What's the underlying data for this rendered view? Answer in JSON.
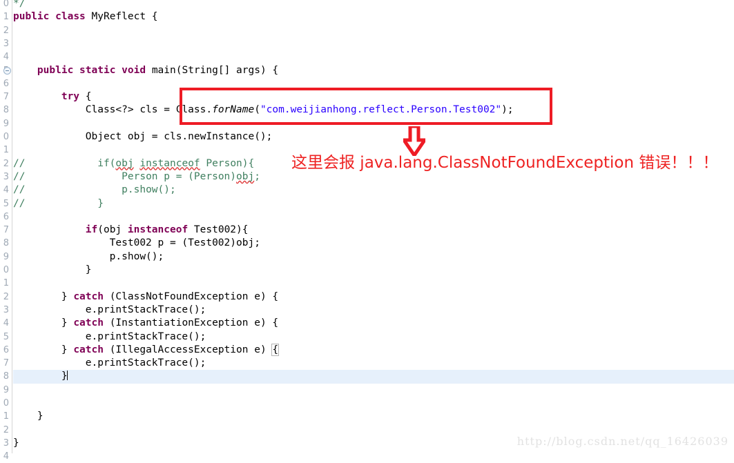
{
  "editor": {
    "font_size_px": 14.5,
    "line_height_px": 19.3,
    "gutter_color": "#9fa9b5",
    "current_line_bg": "#e6f0fb",
    "colors": {
      "keyword": "#7f0055",
      "string": "#2a00ff",
      "comment": "#3f7f5f",
      "plain": "#000000",
      "annotation_red": "#ee1c25",
      "watermark": "#e2e2e2"
    },
    "lines": [
      {
        "num": "0",
        "indent": 1,
        "fold": false,
        "current": false,
        "clipped_top": true,
        "segments": [
          {
            "t": "*/",
            "c": "cmt"
          }
        ]
      },
      {
        "num": "1",
        "indent": 0,
        "fold": false,
        "current": false,
        "segments": [
          {
            "t": "public",
            "c": "kw"
          },
          {
            "t": " ",
            "c": "plain"
          },
          {
            "t": "class",
            "c": "kw"
          },
          {
            "t": " MyReflect {",
            "c": "plain"
          }
        ]
      },
      {
        "num": "2",
        "indent": 0,
        "fold": false,
        "current": false,
        "segments": []
      },
      {
        "num": "3",
        "indent": 0,
        "fold": false,
        "current": false,
        "segments": []
      },
      {
        "num": "4",
        "indent": 0,
        "fold": false,
        "current": false,
        "segments": []
      },
      {
        "num": "5",
        "indent": 0,
        "fold": true,
        "current": false,
        "segments": [
          {
            "t": "    ",
            "c": "plain"
          },
          {
            "t": "public",
            "c": "kw"
          },
          {
            "t": " ",
            "c": "plain"
          },
          {
            "t": "static",
            "c": "kw"
          },
          {
            "t": " ",
            "c": "plain"
          },
          {
            "t": "void",
            "c": "kw"
          },
          {
            "t": " main(String[] args) {",
            "c": "plain"
          }
        ]
      },
      {
        "num": "6",
        "indent": 0,
        "fold": false,
        "current": false,
        "segments": []
      },
      {
        "num": "7",
        "indent": 0,
        "fold": false,
        "current": false,
        "segments": [
          {
            "t": "        ",
            "c": "plain"
          },
          {
            "t": "try",
            "c": "kw"
          },
          {
            "t": " {",
            "c": "plain"
          }
        ]
      },
      {
        "num": "8",
        "indent": 0,
        "fold": false,
        "current": false,
        "segments": [
          {
            "t": "            Class<?> cls = Class.",
            "c": "plain"
          },
          {
            "t": "forName",
            "c": "mth"
          },
          {
            "t": "(",
            "c": "plain"
          },
          {
            "t": "\"com.weijianhong.reflect.Person.Test002\"",
            "c": "str"
          },
          {
            "t": ");",
            "c": "plain"
          }
        ]
      },
      {
        "num": "9",
        "indent": 0,
        "fold": false,
        "current": false,
        "segments": []
      },
      {
        "num": "0",
        "indent": 0,
        "fold": false,
        "current": false,
        "segments": [
          {
            "t": "            Object obj = cls.newInstance();",
            "c": "plain"
          }
        ]
      },
      {
        "num": "1",
        "indent": 0,
        "fold": false,
        "current": false,
        "segments": []
      },
      {
        "num": "2",
        "indent": 0,
        "fold": false,
        "current": false,
        "segments": [
          {
            "t": "//",
            "c": "cmt"
          },
          {
            "t": "            if(",
            "c": "cmt"
          },
          {
            "t": "obj",
            "c": "cmt",
            "squiggle": true
          },
          {
            "t": " ",
            "c": "cmt"
          },
          {
            "t": "instanceof",
            "c": "cmt",
            "squiggle": true
          },
          {
            "t": " Person){",
            "c": "cmt"
          }
        ]
      },
      {
        "num": "3",
        "indent": 0,
        "fold": false,
        "current": false,
        "segments": [
          {
            "t": "//",
            "c": "cmt"
          },
          {
            "t": "                Person p = (Person)",
            "c": "cmt"
          },
          {
            "t": "obj",
            "c": "cmt",
            "squiggle": true
          },
          {
            "t": ";",
            "c": "cmt"
          }
        ]
      },
      {
        "num": "4",
        "indent": 0,
        "fold": false,
        "current": false,
        "segments": [
          {
            "t": "//",
            "c": "cmt"
          },
          {
            "t": "                p.show();",
            "c": "cmt"
          }
        ]
      },
      {
        "num": "5",
        "indent": 0,
        "fold": false,
        "current": false,
        "segments": [
          {
            "t": "//",
            "c": "cmt"
          },
          {
            "t": "            }",
            "c": "cmt"
          }
        ]
      },
      {
        "num": "6",
        "indent": 0,
        "fold": false,
        "current": false,
        "segments": []
      },
      {
        "num": "7",
        "indent": 0,
        "fold": false,
        "current": false,
        "segments": [
          {
            "t": "            ",
            "c": "plain"
          },
          {
            "t": "if",
            "c": "kw"
          },
          {
            "t": "(obj ",
            "c": "plain"
          },
          {
            "t": "instanceof",
            "c": "kw"
          },
          {
            "t": " Test002){",
            "c": "plain"
          }
        ]
      },
      {
        "num": "8",
        "indent": 0,
        "fold": false,
        "current": false,
        "segments": [
          {
            "t": "                Test002 p = (Test002)obj;",
            "c": "plain"
          }
        ]
      },
      {
        "num": "9",
        "indent": 0,
        "fold": false,
        "current": false,
        "segments": [
          {
            "t": "                p.show();",
            "c": "plain"
          }
        ]
      },
      {
        "num": "0",
        "indent": 0,
        "fold": false,
        "current": false,
        "segments": [
          {
            "t": "            }",
            "c": "plain"
          }
        ]
      },
      {
        "num": "1",
        "indent": 0,
        "fold": false,
        "current": false,
        "segments": []
      },
      {
        "num": "2",
        "indent": 0,
        "fold": false,
        "current": false,
        "segments": [
          {
            "t": "        } ",
            "c": "plain"
          },
          {
            "t": "catch",
            "c": "kw"
          },
          {
            "t": " (ClassNotFoundException e) {",
            "c": "plain"
          }
        ]
      },
      {
        "num": "3",
        "indent": 0,
        "fold": false,
        "current": false,
        "segments": [
          {
            "t": "            e.printStackTrace();",
            "c": "plain"
          }
        ]
      },
      {
        "num": "4",
        "indent": 0,
        "fold": false,
        "current": false,
        "segments": [
          {
            "t": "        } ",
            "c": "plain"
          },
          {
            "t": "catch",
            "c": "kw"
          },
          {
            "t": " (InstantiationException e) {",
            "c": "plain"
          }
        ]
      },
      {
        "num": "5",
        "indent": 0,
        "fold": false,
        "current": false,
        "segments": [
          {
            "t": "            e.printStackTrace();",
            "c": "plain"
          }
        ]
      },
      {
        "num": "6",
        "indent": 0,
        "fold": false,
        "current": false,
        "segments": [
          {
            "t": "        } ",
            "c": "plain"
          },
          {
            "t": "catch",
            "c": "kw"
          },
          {
            "t": " (IllegalAccessException e) ",
            "c": "plain"
          },
          {
            "t": "{",
            "c": "plain",
            "bracket_match": true
          }
        ]
      },
      {
        "num": "7",
        "indent": 0,
        "fold": false,
        "current": false,
        "segments": [
          {
            "t": "            e.printStackTrace();",
            "c": "plain"
          }
        ]
      },
      {
        "num": "8",
        "indent": 0,
        "fold": false,
        "current": true,
        "caret": true,
        "segments": [
          {
            "t": "        }",
            "c": "plain"
          }
        ]
      },
      {
        "num": "9",
        "indent": 0,
        "fold": false,
        "current": false,
        "segments": []
      },
      {
        "num": "0",
        "indent": 0,
        "fold": false,
        "current": false,
        "segments": []
      },
      {
        "num": "1",
        "indent": 0,
        "fold": false,
        "current": false,
        "segments": [
          {
            "t": "    }",
            "c": "plain"
          }
        ]
      },
      {
        "num": "2",
        "indent": 0,
        "fold": false,
        "current": false,
        "segments": []
      },
      {
        "num": "3",
        "indent": 0,
        "fold": false,
        "current": false,
        "segments": [
          {
            "t": "}",
            "c": "plain"
          }
        ]
      },
      {
        "num": "4",
        "indent": 0,
        "fold": false,
        "current": false,
        "segments": []
      }
    ]
  },
  "annotation": {
    "highlight_box_label": "Class.forName(\"com.weijianhong.reflect.Person.Test002\");",
    "arrow_direction": "down",
    "text": "这里会报 java.lang.ClassNotFoundException 错误！！！",
    "color": "#ee2222"
  },
  "watermark": {
    "text": "http://blog.csdn.net/qq_16426039"
  }
}
